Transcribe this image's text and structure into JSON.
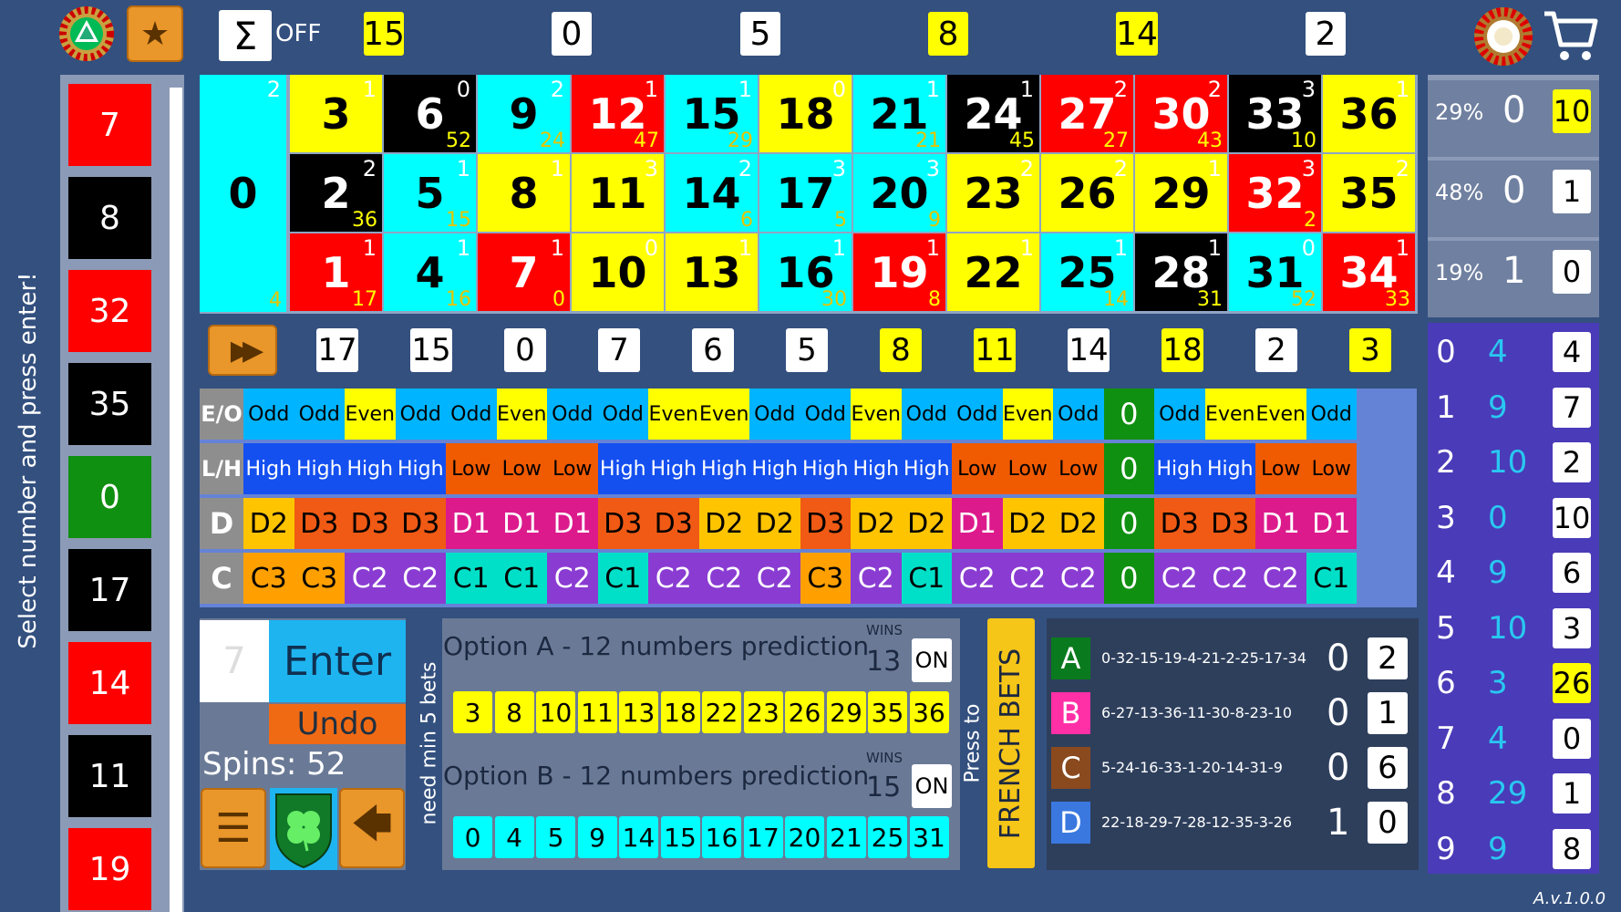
{
  "colors": {
    "red": "#ff0000",
    "black": "#000000",
    "yellow": "#ffff00",
    "cyan": "#00ffff",
    "green": "#109010",
    "blue_bg": "#33507f",
    "purple": "#4a3bb8"
  },
  "icons": {
    "app_wheel": "roulette-wheel-icon",
    "favorite": "star-icon",
    "sum": "sigma-icon",
    "cart": "shopping-cart-icon",
    "list": "list-icon",
    "clover": "clover-icon",
    "back": "back-arrow-icon",
    "fast_forward": "fast-forward-icon"
  },
  "toolbar": {
    "sum_symbol": "Σ",
    "sum_state": "OFF",
    "top_numbers": [
      "15",
      "0",
      "5",
      "8",
      "14",
      "2"
    ]
  },
  "sidebar": {
    "hint": "Select number and press enter!",
    "history": [
      "7",
      "8",
      "32",
      "35",
      "0",
      "17",
      "14",
      "11",
      "19"
    ]
  },
  "board": {
    "zero": {
      "number": "0",
      "top": "2",
      "bottom": "4"
    },
    "columns": [
      [
        {
          "n": "3",
          "t": "1",
          "b": ""
        },
        {
          "n": "2",
          "t": "2",
          "b": "36"
        },
        {
          "n": "1",
          "t": "1",
          "b": "17"
        }
      ],
      [
        {
          "n": "6",
          "t": "0",
          "b": "52"
        },
        {
          "n": "5",
          "t": "1",
          "b": "15"
        },
        {
          "n": "4",
          "t": "1",
          "b": "16"
        }
      ],
      [
        {
          "n": "9",
          "t": "2",
          "b": "24"
        },
        {
          "n": "8",
          "t": "1",
          "b": ""
        },
        {
          "n": "7",
          "t": "1",
          "b": "0"
        }
      ],
      [
        {
          "n": "12",
          "t": "1",
          "b": "47"
        },
        {
          "n": "11",
          "t": "3",
          "b": ""
        },
        {
          "n": "10",
          "t": "0",
          "b": ""
        }
      ],
      [
        {
          "n": "15",
          "t": "1",
          "b": "29"
        },
        {
          "n": "14",
          "t": "2",
          "b": "6"
        },
        {
          "n": "13",
          "t": "1",
          "b": ""
        }
      ],
      [
        {
          "n": "18",
          "t": "0",
          "b": ""
        },
        {
          "n": "17",
          "t": "3",
          "b": "5"
        },
        {
          "n": "16",
          "t": "1",
          "b": "30"
        }
      ],
      [
        {
          "n": "21",
          "t": "1",
          "b": "21"
        },
        {
          "n": "20",
          "t": "3",
          "b": "9"
        },
        {
          "n": "19",
          "t": "1",
          "b": "8"
        }
      ],
      [
        {
          "n": "24",
          "t": "1",
          "b": "45"
        },
        {
          "n": "23",
          "t": "2",
          "b": ""
        },
        {
          "n": "22",
          "t": "1",
          "b": ""
        }
      ],
      [
        {
          "n": "27",
          "t": "2",
          "b": "27"
        },
        {
          "n": "26",
          "t": "2",
          "b": ""
        },
        {
          "n": "25",
          "t": "1",
          "b": "14"
        }
      ],
      [
        {
          "n": "30",
          "t": "2",
          "b": "43"
        },
        {
          "n": "29",
          "t": "1",
          "b": ""
        },
        {
          "n": "28",
          "t": "1",
          "b": "31"
        }
      ],
      [
        {
          "n": "33",
          "t": "3",
          "b": "10"
        },
        {
          "n": "32",
          "t": "3",
          "b": "2"
        },
        {
          "n": "31",
          "t": "0",
          "b": "52"
        }
      ],
      [
        {
          "n": "36",
          "t": "1",
          "b": ""
        },
        {
          "n": "35",
          "t": "2",
          "b": ""
        },
        {
          "n": "34",
          "t": "1",
          "b": "33"
        }
      ]
    ]
  },
  "history_row": [
    "17",
    "15",
    "0",
    "7",
    "6",
    "5",
    "8",
    "11",
    "14",
    "18",
    "2",
    "3"
  ],
  "trend_table": {
    "labels": [
      "E/O",
      "L/H",
      "D",
      "C"
    ],
    "rows": [
      [
        "Odd",
        "Odd",
        "Even",
        "Odd",
        "Odd",
        "Even",
        "Odd",
        "Odd",
        "Even",
        "Even",
        "Odd",
        "Odd",
        "Even",
        "Odd",
        "Odd",
        "Even",
        "Odd",
        "0",
        "Odd",
        "Even",
        "Even",
        "Odd"
      ],
      [
        "High",
        "High",
        "High",
        "High",
        "Low",
        "Low",
        "Low",
        "High",
        "High",
        "High",
        "High",
        "High",
        "High",
        "High",
        "Low",
        "Low",
        "Low",
        "0",
        "High",
        "High",
        "Low",
        "Low"
      ],
      [
        "D2",
        "D3",
        "D3",
        "D3",
        "D1",
        "D1",
        "D1",
        "D3",
        "D3",
        "D2",
        "D2",
        "D3",
        "D2",
        "D2",
        "D1",
        "D2",
        "D2",
        "0",
        "D3",
        "D3",
        "D1",
        "D1"
      ],
      [
        "C3",
        "C3",
        "C2",
        "C2",
        "C1",
        "C1",
        "C2",
        "C1",
        "C2",
        "C2",
        "C2",
        "C3",
        "C2",
        "C1",
        "C2",
        "C2",
        "C2",
        "0",
        "C2",
        "C2",
        "C2",
        "C1"
      ]
    ]
  },
  "input": {
    "value": "7",
    "enter_label": "Enter",
    "undo_label": "Undo",
    "spins": "Spins: 52"
  },
  "predictions": {
    "side_note": "need min 5 bets",
    "option_a": {
      "title": "Option A - 12 numbers prediction",
      "wins_label": "WINS",
      "wins": "13",
      "toggle": "ON",
      "numbers": [
        "3",
        "8",
        "10",
        "11",
        "13",
        "18",
        "22",
        "23",
        "26",
        "29",
        "35",
        "36"
      ]
    },
    "option_b": {
      "title": "Option B - 12 numbers prediction",
      "wins_label": "WINS",
      "wins": "15",
      "toggle": "ON",
      "numbers": [
        "0",
        "4",
        "5",
        "9",
        "14",
        "15",
        "16",
        "17",
        "20",
        "21",
        "25",
        "31"
      ]
    }
  },
  "french": {
    "press_to": "Press to",
    "button": "FRENCH BETS",
    "bets": [
      {
        "letter": "A",
        "seq": "0-32-15-19-4-21-2-25-17-34",
        "count": "0",
        "box": "2",
        "color": "#0a7a1e"
      },
      {
        "letter": "B",
        "seq": "6-27-13-36-11-30-8-23-10",
        "count": "0",
        "box": "1",
        "color": "#ff2fa6"
      },
      {
        "letter": "C",
        "seq": "5-24-16-33-1-20-14-31-9",
        "count": "0",
        "box": "6",
        "color": "#8a4a1e"
      },
      {
        "letter": "D",
        "seq": "22-18-29-7-28-12-35-3-26",
        "count": "1",
        "box": "0",
        "color": "#3a78e0"
      }
    ]
  },
  "percent_panel": [
    {
      "pct": "29%",
      "count": "0",
      "box": "10",
      "highlight": true
    },
    {
      "pct": "48%",
      "count": "0",
      "box": "1",
      "highlight": false
    },
    {
      "pct": "19%",
      "count": "1",
      "box": "0",
      "highlight": false
    }
  ],
  "digit_panel": [
    {
      "d": "0",
      "v": "4",
      "box": "4",
      "hl": false
    },
    {
      "d": "1",
      "v": "9",
      "box": "7",
      "hl": false
    },
    {
      "d": "2",
      "v": "10",
      "box": "2",
      "hl": false
    },
    {
      "d": "3",
      "v": "0",
      "box": "10",
      "hl": false
    },
    {
      "d": "4",
      "v": "9",
      "box": "6",
      "hl": false
    },
    {
      "d": "5",
      "v": "10",
      "box": "3",
      "hl": false
    },
    {
      "d": "6",
      "v": "3",
      "box": "26",
      "hl": true
    },
    {
      "d": "7",
      "v": "4",
      "box": "0",
      "hl": false
    },
    {
      "d": "8",
      "v": "29",
      "box": "1",
      "hl": false
    },
    {
      "d": "9",
      "v": "9",
      "box": "8",
      "hl": false
    }
  ],
  "version": "A.v.1.0.0"
}
